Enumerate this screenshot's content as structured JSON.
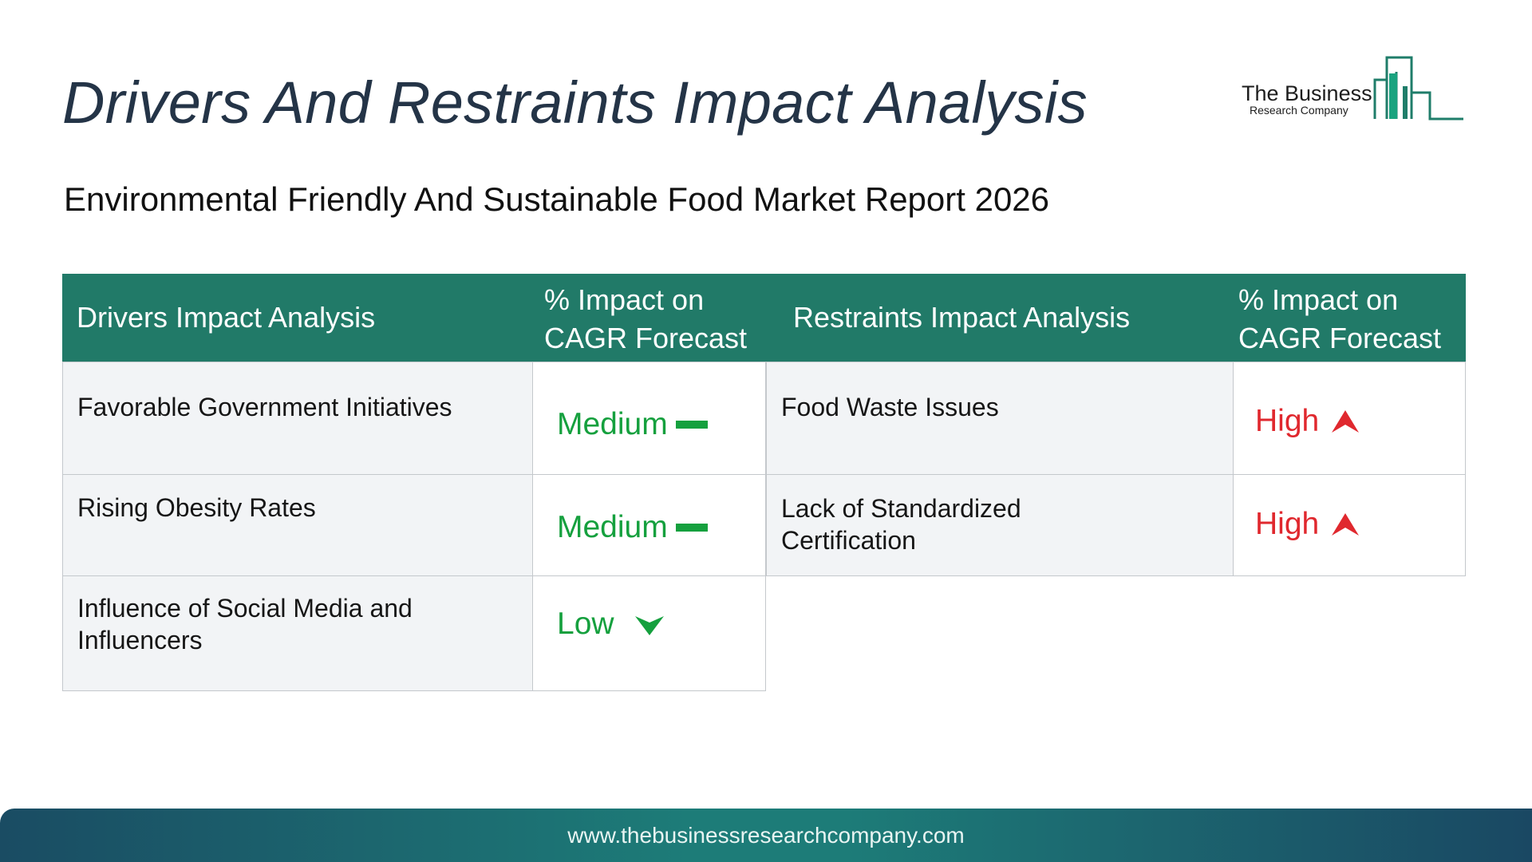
{
  "header": {
    "title": "Drivers And Restraints Impact Analysis",
    "subtitle": "Environmental Friendly And Sustainable Food Market Report 2026"
  },
  "logo": {
    "line1": "The Business",
    "line2": "Research Company"
  },
  "table": {
    "columns": [
      "Drivers Impact Analysis",
      "% Impact on CAGR Forecast",
      "Restraints Impact Analysis",
      "% Impact on CAGR Forecast"
    ],
    "drivers": [
      {
        "label": "Favorable Government Initiatives",
        "impact": "Medium",
        "icon": "dash-icon"
      },
      {
        "label": "Rising Obesity Rates",
        "impact": "Medium",
        "icon": "dash-icon"
      },
      {
        "label": "Influence of Social Media and Influencers",
        "impact": "Low",
        "icon": "arrow-down-icon"
      }
    ],
    "restraints": [
      {
        "label": "Food Waste Issues",
        "impact": "High",
        "icon": "arrow-up-icon"
      },
      {
        "label": "Lack of Standardized Certification",
        "impact": "High",
        "icon": "arrow-up-icon"
      }
    ]
  },
  "colors": {
    "header_bg": "#217a68",
    "medium_low": "#15a03e",
    "high": "#e0282e",
    "title": "#243447"
  },
  "footer": {
    "url": "www.thebusinessresearchcompany.com"
  }
}
